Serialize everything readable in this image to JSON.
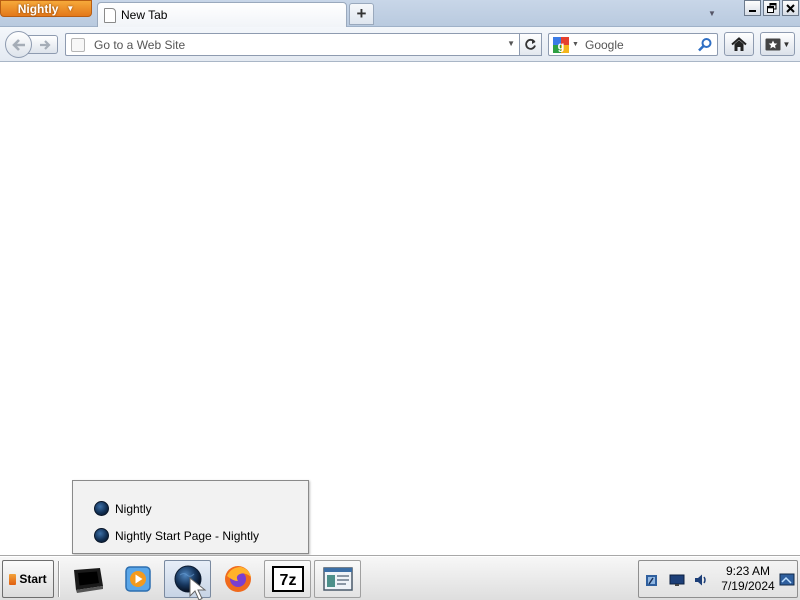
{
  "app_button": {
    "label": "Nightly"
  },
  "tabs": [
    {
      "title": "New Tab"
    }
  ],
  "toolbar": {
    "url_placeholder": "Go to a Web Site",
    "search_placeholder": "Google"
  },
  "taskbar_popup": {
    "items": [
      {
        "label": "Nightly"
      },
      {
        "label": "Nightly Start Page - Nightly"
      }
    ]
  },
  "taskbar": {
    "start_label": "Start",
    "clock": {
      "time": "9:23 AM",
      "date": "7/19/2024"
    }
  },
  "icons": {
    "app_menu": "chevron-down-icon",
    "tab": "page-icon",
    "new_tab": "plus-icon",
    "back": "arrow-left-icon",
    "forward": "arrow-right-icon",
    "reload": "reload-icon",
    "search_engine": "google-icon",
    "search_go": "magnifier-icon",
    "home": "home-icon",
    "bookmarks": "bookmark-star-icon",
    "taskbar_apps": [
      "terminal-icon",
      "media-player-icon",
      "nightly-globe-icon",
      "firefox-icon",
      "7zip-icon",
      "window-icon"
    ]
  },
  "colors": {
    "app_button": "#e8821f",
    "titlebar": "#c8d6e8",
    "toolbar": "#eaeff5",
    "taskbar": "#e8e8e8"
  }
}
